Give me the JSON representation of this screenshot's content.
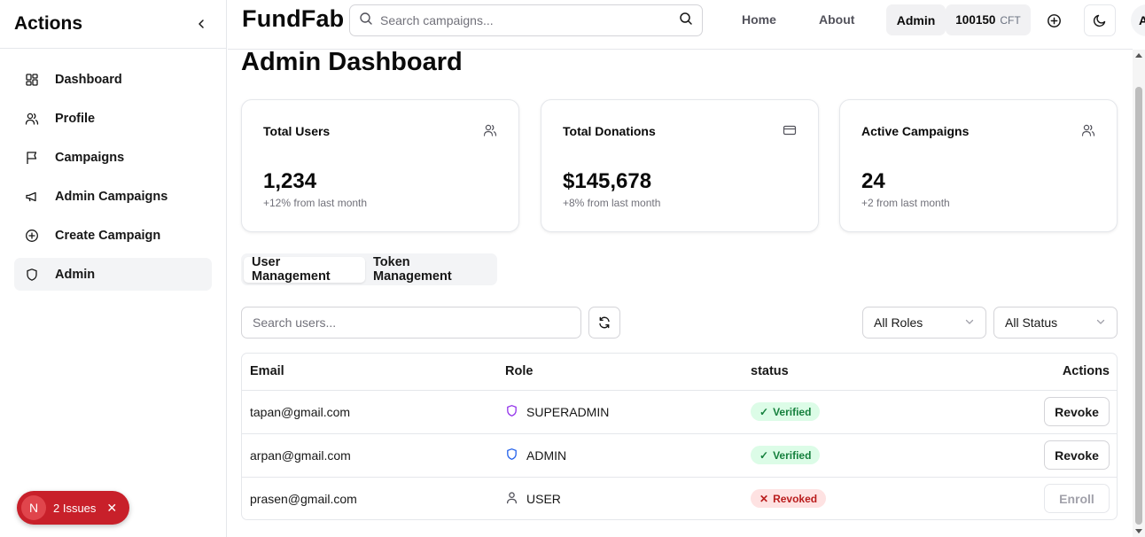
{
  "sidebar": {
    "title": "Actions",
    "items": [
      {
        "label": "Dashboard",
        "icon": "dashboard-icon"
      },
      {
        "label": "Profile",
        "icon": "users-icon"
      },
      {
        "label": "Campaigns",
        "icon": "flag-icon"
      },
      {
        "label": "Admin Campaigns",
        "icon": "megaphone-icon"
      },
      {
        "label": "Create Campaign",
        "icon": "plus-circle-icon"
      },
      {
        "label": "Admin",
        "icon": "shield-icon",
        "active": true
      }
    ]
  },
  "issues": {
    "avatar_letter": "N",
    "label": "2 Issues",
    "accent": "#c8202a"
  },
  "header": {
    "brand": "FundFab",
    "search_placeholder": "Search campaigns...",
    "nav": [
      "Home",
      "About"
    ],
    "role_chip": "Admin",
    "balance": "100150",
    "balance_unit": "CFT",
    "avatar_letter": "A"
  },
  "main": {
    "title": "Admin Dashboard",
    "cards": [
      {
        "label": "Total Users",
        "value": "1,234",
        "sub": "+12% from last month",
        "icon": "users-icon"
      },
      {
        "label": "Total Donations",
        "value": "$145,678",
        "sub": "+8% from last month",
        "icon": "credit-card-icon"
      },
      {
        "label": "Active Campaigns",
        "value": "24",
        "sub": "+2 from last month",
        "icon": "users-icon"
      }
    ],
    "tabs": [
      {
        "label": "User Management",
        "active": true
      },
      {
        "label": "Token Management",
        "active": false
      }
    ],
    "user_search_placeholder": "Search users...",
    "filters": {
      "roles": "All Roles",
      "status": "All Status"
    },
    "table": {
      "headers": [
        "Email",
        "Role",
        "status",
        "Actions"
      ],
      "rows": [
        {
          "email": "tapan@gmail.com",
          "role": "SUPERADMIN",
          "role_icon": "shield-icon",
          "role_color": "#9333ea",
          "status": "Verified",
          "status_type": "verified",
          "action": "Revoke"
        },
        {
          "email": "arpan@gmail.com",
          "role": "ADMIN",
          "role_icon": "shield-icon",
          "role_color": "#2563eb",
          "status": "Verified",
          "status_type": "verified",
          "action": "Revoke"
        },
        {
          "email": "prasen@gmail.com",
          "role": "USER",
          "role_icon": "user-icon",
          "role_color": "#52525b",
          "status": "Revoked",
          "status_type": "revoked",
          "action": "Enroll"
        }
      ]
    }
  }
}
